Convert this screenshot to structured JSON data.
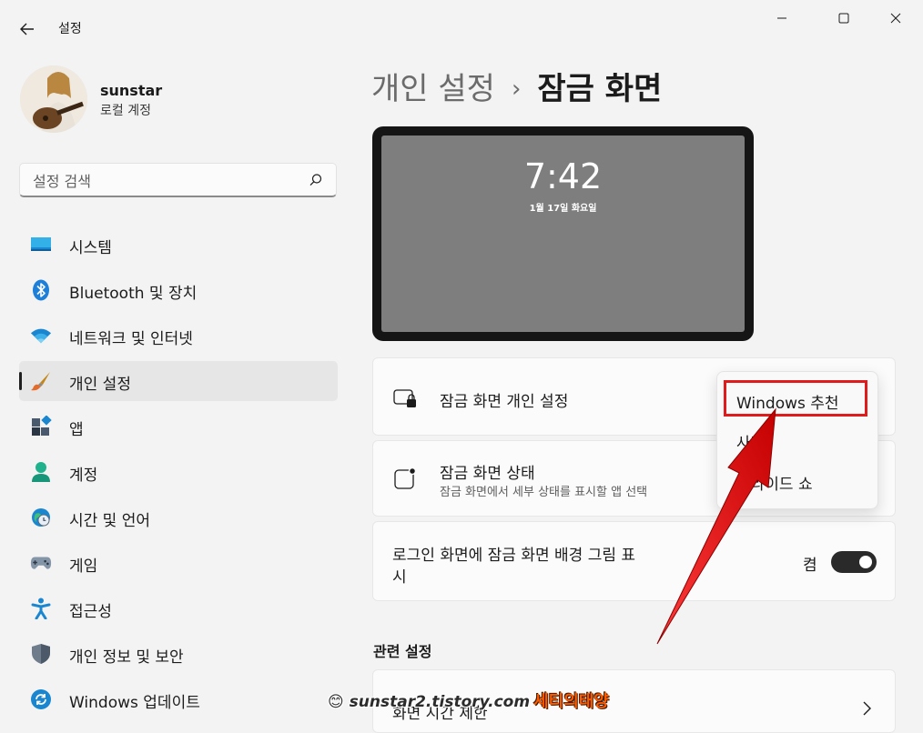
{
  "window": {
    "app_title": "설정",
    "back_label": "←"
  },
  "profile": {
    "name": "sunstar",
    "account_type": "로컬 계정"
  },
  "search": {
    "placeholder": "설정 검색"
  },
  "nav": {
    "items": [
      {
        "label": "시스템",
        "icon": "system-icon"
      },
      {
        "label": "Bluetooth 및 장치",
        "icon": "bluetooth-icon"
      },
      {
        "label": "네트워크 및 인터넷",
        "icon": "network-icon"
      },
      {
        "label": "개인 설정",
        "icon": "personalization-brush-icon",
        "selected": true
      },
      {
        "label": "앱",
        "icon": "apps-icon"
      },
      {
        "label": "계정",
        "icon": "account-icon"
      },
      {
        "label": "시간 및 언어",
        "icon": "time-language-icon"
      },
      {
        "label": "게임",
        "icon": "gaming-icon"
      },
      {
        "label": "접근성",
        "icon": "accessibility-icon"
      },
      {
        "label": "개인 정보 및 보안",
        "icon": "privacy-shield-icon"
      },
      {
        "label": "Windows 업데이트",
        "icon": "windows-update-icon"
      }
    ]
  },
  "main": {
    "breadcrumb_parent": "개인 설정",
    "breadcrumb_separator": "›",
    "breadcrumb_current": "잠금 화면",
    "preview": {
      "time": "7:42",
      "date": "1월 17일 화요일"
    },
    "personalize_card": {
      "title": "잠금 화면 개인 설정"
    },
    "status_card": {
      "title": "잠금 화면 상태",
      "subtitle": "잠금 화면에서 세부 상태를 표시할 앱 선택"
    },
    "signin_card": {
      "title_line1": "로그인 화면에 잠금 화면 배경 그림 표",
      "title_line2": "시",
      "toggle_label": "켬",
      "toggle_on": true
    },
    "dropdown": {
      "options": [
        "Windows 추천",
        "사진",
        "슬라이드 쇼"
      ],
      "selected": "Windows 추천"
    },
    "related": {
      "title": "관련 설정",
      "first_item": "화면 시간 제한"
    }
  },
  "watermark": {
    "text": "sunstar2.tistory.com",
    "korean": "세티의태양"
  },
  "colors": {
    "accent_highlight": "#e01b1b",
    "arrow": "#e01b1b",
    "toggle_on": "#2a2a2a"
  }
}
